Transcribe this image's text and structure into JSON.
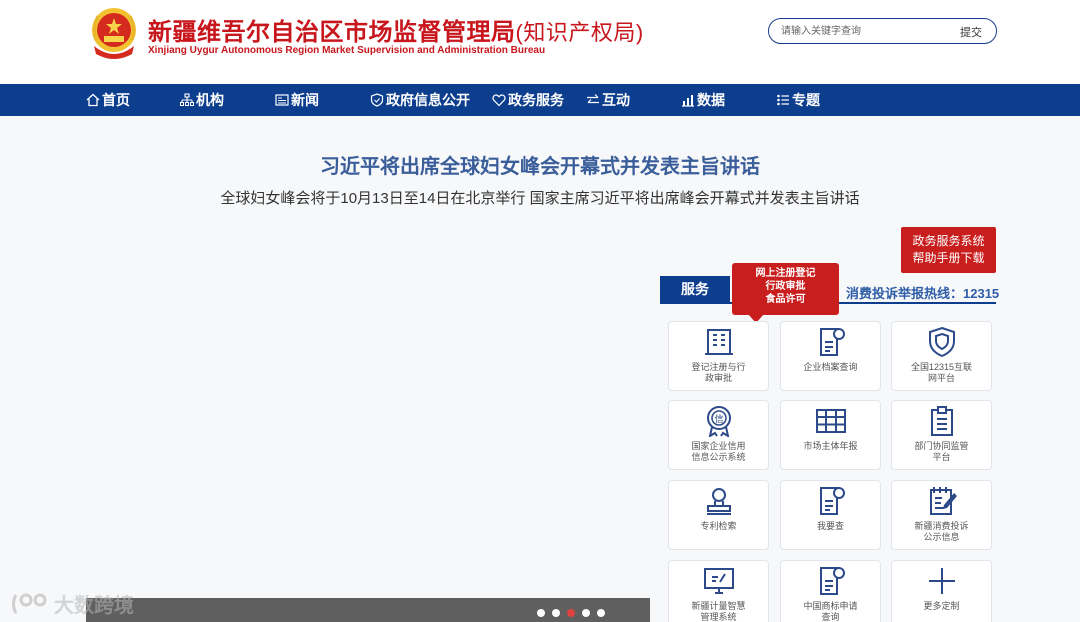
{
  "header": {
    "title": "新疆维吾尔自治区市场监督管理局",
    "title_suffix": "(知识产权局)",
    "subtitle_en": "Xinjiang Uygur Autonomous Region Market Supervision and Administration Bureau"
  },
  "search": {
    "placeholder": "请输入关键字查询",
    "submit_label": "提交"
  },
  "nav": {
    "items": [
      {
        "label": "首页",
        "icon": "home-icon"
      },
      {
        "label": "机构",
        "icon": "org-chart-icon"
      },
      {
        "label": "新闻",
        "icon": "news-icon"
      },
      {
        "label": "政府信息公开",
        "icon": "shield-icon"
      },
      {
        "label": "政务服务",
        "icon": "heart-icon"
      },
      {
        "label": "互动",
        "icon": "exchange-icon"
      },
      {
        "label": "数据",
        "icon": "chart-icon"
      },
      {
        "label": "专题",
        "icon": "list-icon"
      }
    ]
  },
  "headline": {
    "title": "习近平将出席全球妇女峰会开幕式并发表主旨讲话",
    "summary": "全球妇女峰会将于10月13日至14日在北京举行 国家主席习近平将出席峰会开幕式并发表主旨讲话"
  },
  "carousel": {
    "slides": 5,
    "active_index": 2
  },
  "watermark": {
    "text": "大数跨境"
  },
  "service": {
    "help_line1": "政务服务系统",
    "help_line2": "帮助手册下载",
    "tab_label": "服务",
    "popup_line1": "网上注册登记",
    "popup_line2": "行政审批",
    "popup_line3": "食品许可",
    "hotline": "消费投诉举报热线：12315",
    "tiles": [
      {
        "line1": "登记注册与行",
        "line2": "政审批",
        "icon": "building-icon"
      },
      {
        "line1": "企业档案查询",
        "line2": "",
        "icon": "document-search-icon"
      },
      {
        "line1": "全国12315互联",
        "line2": "网平台",
        "icon": "shield-icon"
      },
      {
        "line1": "国家企业信用",
        "line2": "信息公示系统",
        "icon": "credit-badge-icon"
      },
      {
        "line1": "市场主体年报",
        "line2": "",
        "icon": "table-icon"
      },
      {
        "line1": "部门协同监管",
        "line2": "平台",
        "icon": "clipboard-icon"
      },
      {
        "line1": "专利检索",
        "line2": "",
        "icon": "user-stamp-icon"
      },
      {
        "line1": "我要查",
        "line2": "",
        "icon": "document-search-icon"
      },
      {
        "line1": "新疆消费投诉",
        "line2": "公示信息",
        "icon": "edit-document-icon"
      },
      {
        "line1": "新疆计量智慧",
        "line2": "管理系统",
        "icon": "monitor-icon"
      },
      {
        "line1": "中国商标申请",
        "line2": "查询",
        "icon": "document-search-icon"
      },
      {
        "line1": "更多定制",
        "line2": "",
        "icon": "plus-icon"
      }
    ]
  },
  "colors": {
    "brand_red": "#c8161d",
    "nav_blue": "#0d3e8e",
    "headline_blue": "#3a5e9a",
    "hotline_blue": "#2f5da8"
  }
}
